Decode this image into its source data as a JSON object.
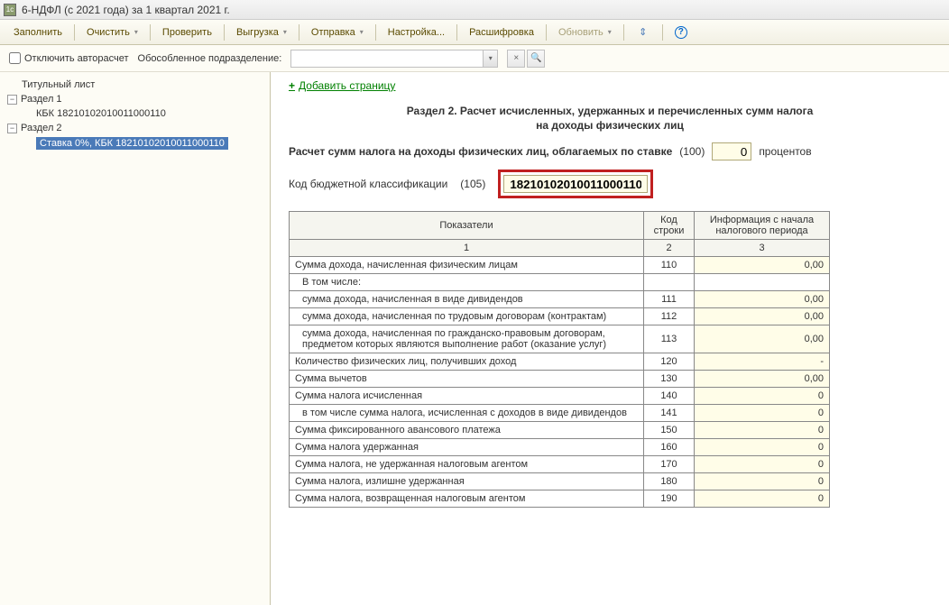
{
  "window": {
    "title": "6-НДФЛ (с 2021 года) за 1 квартал 2021 г."
  },
  "toolbar": {
    "fill": "Заполнить",
    "clear": "Очистить",
    "check": "Проверить",
    "export": "Выгрузка",
    "send": "Отправка",
    "settings": "Настройка...",
    "decode": "Расшифровка",
    "refresh": "Обновить"
  },
  "subbar": {
    "disable_autocalc": "Отключить авторасчет",
    "subdivision_label": "Обособленное подразделение:"
  },
  "tree": {
    "title_page": "Титульный лист",
    "section1": "Раздел 1",
    "kbk1": "КБК 18210102010011000110",
    "section2": "Раздел 2",
    "rate_kbk": "Ставка 0%, КБК 18210102010011000110"
  },
  "main": {
    "add_page": "Добавить страницу",
    "section_title_1": "Раздел 2. Расчет исчисленных, удержанных и перечисленных сумм налога",
    "section_title_2": "на доходы физических лиц",
    "rate_label": "Расчет сумм налога на доходы физических лиц, облагаемых по ставке",
    "rate_code": "(100)",
    "rate_value": "0",
    "rate_suffix": "процентов",
    "kbk_label": "Код бюджетной классификации",
    "kbk_code": "(105)",
    "kbk_value": "18210102010011000110"
  },
  "table": {
    "head_indicator": "Показатели",
    "head_code": "Код строки",
    "head_info": "Информация с начала налогового периода",
    "subhead_1": "1",
    "subhead_2": "2",
    "subhead_3": "3",
    "rows": [
      {
        "label": "Сумма дохода, начисленная физическим лицам",
        "code": "110",
        "value": "0,00",
        "indent": false
      },
      {
        "label": "В том числе:",
        "code": "",
        "value": "",
        "indent": true
      },
      {
        "label": "сумма дохода, начисленная в виде дивидендов",
        "code": "111",
        "value": "0,00",
        "indent": true
      },
      {
        "label": "сумма дохода, начисленная по трудовым договорам (контрактам)",
        "code": "112",
        "value": "0,00",
        "indent": true
      },
      {
        "label": "сумма дохода, начисленная по гражданско-правовым договорам, предметом которых являются выполнение работ (оказание услуг)",
        "code": "113",
        "value": "0,00",
        "indent": true
      },
      {
        "label": "Количество физических лиц, получивших доход",
        "code": "120",
        "value": "-",
        "indent": false
      },
      {
        "label": "Сумма вычетов",
        "code": "130",
        "value": "0,00",
        "indent": false
      },
      {
        "label": "Сумма налога исчисленная",
        "code": "140",
        "value": "0",
        "indent": false
      },
      {
        "label": "в том числе сумма налога, исчисленная с доходов в виде дивидендов",
        "code": "141",
        "value": "0",
        "indent": true
      },
      {
        "label": "Сумма фиксированного авансового платежа",
        "code": "150",
        "value": "0",
        "indent": false
      },
      {
        "label": "Сумма налога удержанная",
        "code": "160",
        "value": "0",
        "indent": false
      },
      {
        "label": "Сумма налога, не удержанная налоговым агентом",
        "code": "170",
        "value": "0",
        "indent": false
      },
      {
        "label": "Сумма налога, излишне удержанная",
        "code": "180",
        "value": "0",
        "indent": false
      },
      {
        "label": "Сумма налога, возвращенная налоговым агентом",
        "code": "190",
        "value": "0",
        "indent": false
      }
    ]
  }
}
